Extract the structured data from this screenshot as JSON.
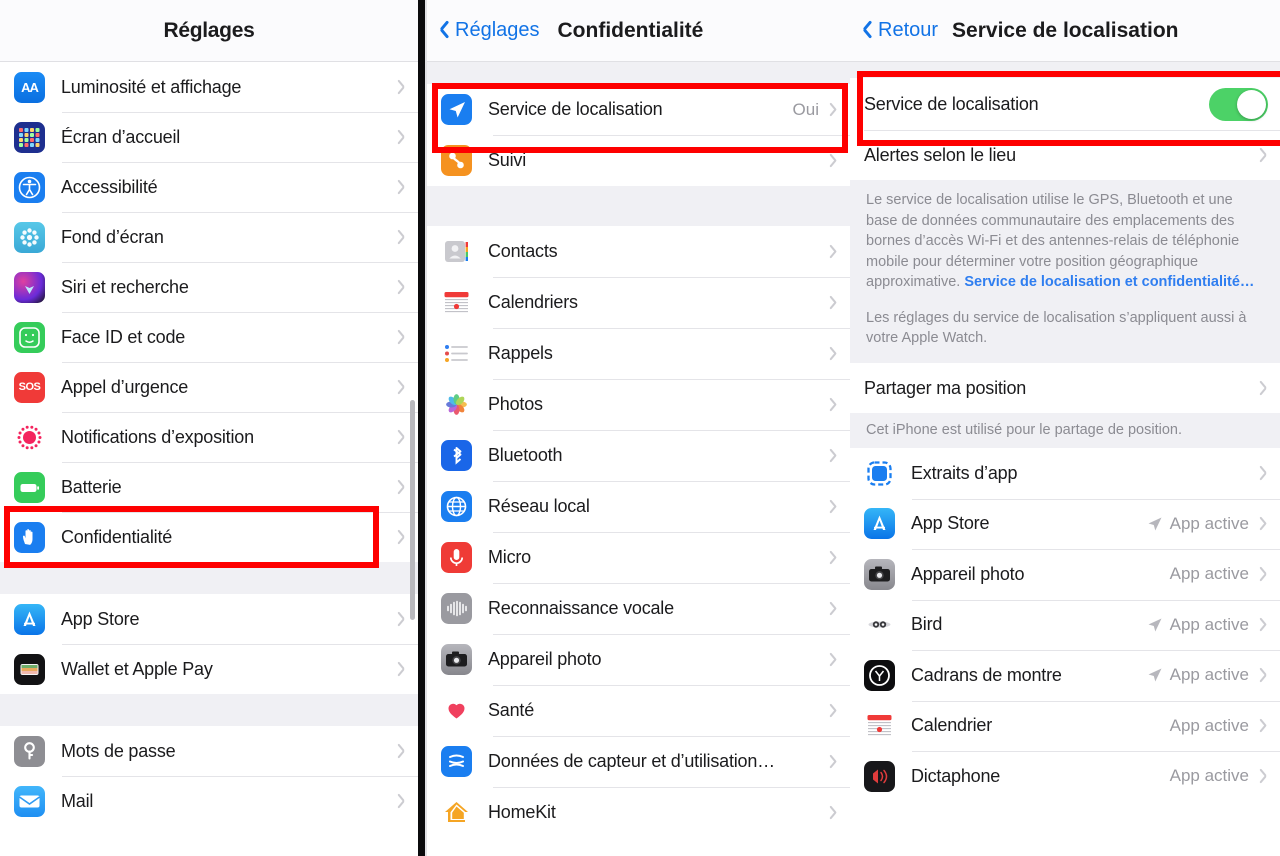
{
  "panels": {
    "left": {
      "nav": {
        "title": "Réglages"
      },
      "groups": [
        {
          "rows": [
            {
              "label": "Luminosité et affichage",
              "icon": "display-brightness-icon"
            },
            {
              "label": "Écran d’accueil",
              "icon": "home-screen-icon"
            },
            {
              "label": "Accessibilité",
              "icon": "accessibility-icon"
            },
            {
              "label": "Fond d’écran",
              "icon": "wallpaper-icon"
            },
            {
              "label": "Siri et recherche",
              "icon": "siri-icon"
            },
            {
              "label": "Face ID et code",
              "icon": "face-id-icon"
            },
            {
              "label": "Appel d’urgence",
              "icon": "sos-icon"
            },
            {
              "label": "Notifications d’exposition",
              "icon": "exposure-notifications-icon"
            },
            {
              "label": "Batterie",
              "icon": "battery-icon"
            },
            {
              "label": "Confidentialité",
              "icon": "privacy-hand-icon",
              "highlighted": true
            }
          ]
        },
        {
          "rows": [
            {
              "label": "App Store",
              "icon": "app-store-icon"
            },
            {
              "label": "Wallet et Apple Pay",
              "icon": "wallet-icon"
            }
          ]
        },
        {
          "rows": [
            {
              "label": "Mots de passe",
              "icon": "passwords-key-icon"
            },
            {
              "label": "Mail",
              "icon": "mail-icon"
            }
          ]
        }
      ]
    },
    "middle": {
      "nav": {
        "back_label": "Réglages",
        "title": "Confidentialité"
      },
      "groups": [
        {
          "rows": [
            {
              "label": "Service de localisation",
              "value": "Oui",
              "icon": "location-services-icon",
              "highlighted": true
            },
            {
              "label": "Suivi",
              "icon": "tracking-icon"
            }
          ]
        },
        {
          "rows": [
            {
              "label": "Contacts",
              "icon": "contacts-icon"
            },
            {
              "label": "Calendriers",
              "icon": "calendar-icon"
            },
            {
              "label": "Rappels",
              "icon": "reminders-icon"
            },
            {
              "label": "Photos",
              "icon": "photos-icon"
            },
            {
              "label": "Bluetooth",
              "icon": "bluetooth-icon"
            },
            {
              "label": "Réseau local",
              "icon": "local-network-icon"
            },
            {
              "label": "Micro",
              "icon": "microphone-icon"
            },
            {
              "label": "Reconnaissance vocale",
              "icon": "speech-recognition-icon"
            },
            {
              "label": "Appareil photo",
              "icon": "camera-icon"
            },
            {
              "label": "Santé",
              "icon": "health-icon"
            },
            {
              "label": "Données de capteur et d’utilisation…",
              "icon": "sensor-data-icon"
            },
            {
              "label": "HomeKit",
              "icon": "homekit-icon"
            }
          ]
        }
      ]
    },
    "right": {
      "nav": {
        "back_label": "Retour",
        "title": "Service de localisation"
      },
      "toggle_row": {
        "label": "Service de localisation",
        "state": "on"
      },
      "alerts_row": {
        "label": "Alertes selon le lieu"
      },
      "info": {
        "paragraph1_before_link": "Le service de localisation utilise le GPS, Bluetooth et une base de données communautaire des emplacements des bornes d’accès Wi-Fi et des antennes-relais de téléphonie mobile pour déterminer votre position géographique approximative. ",
        "link_text": "Service de localisation et confidentialité…",
        "paragraph2": "Les réglages du service de localisation s’appliquent aussi à votre Apple Watch."
      },
      "share_row": {
        "label": "Partager ma position"
      },
      "share_footnote": "Cet iPhone est utilisé pour le partage de position.",
      "apps": [
        {
          "label": "Extraits d’app",
          "icon": "app-clips-icon",
          "value": "",
          "arrow": false
        },
        {
          "label": "App Store",
          "icon": "app-store-icon",
          "value": "App active",
          "arrow": true
        },
        {
          "label": "Appareil photo",
          "icon": "camera-icon",
          "value": "App active",
          "arrow": false
        },
        {
          "label": "Bird",
          "icon": "bird-icon",
          "value": "App active",
          "arrow": true
        },
        {
          "label": "Cadrans de montre",
          "icon": "watch-faces-icon",
          "value": "App active",
          "arrow": true
        },
        {
          "label": "Calendrier",
          "icon": "calendar-icon",
          "value": "App active",
          "arrow": false
        },
        {
          "label": "Dictaphone",
          "icon": "voice-memos-icon",
          "value": "App active",
          "arrow": false
        }
      ]
    }
  },
  "colors": {
    "accent_blue": "#1273e6",
    "highlight_red": "#fe0000",
    "toggle_green": "#4cd267",
    "group_bg": "#f0f0f4"
  }
}
